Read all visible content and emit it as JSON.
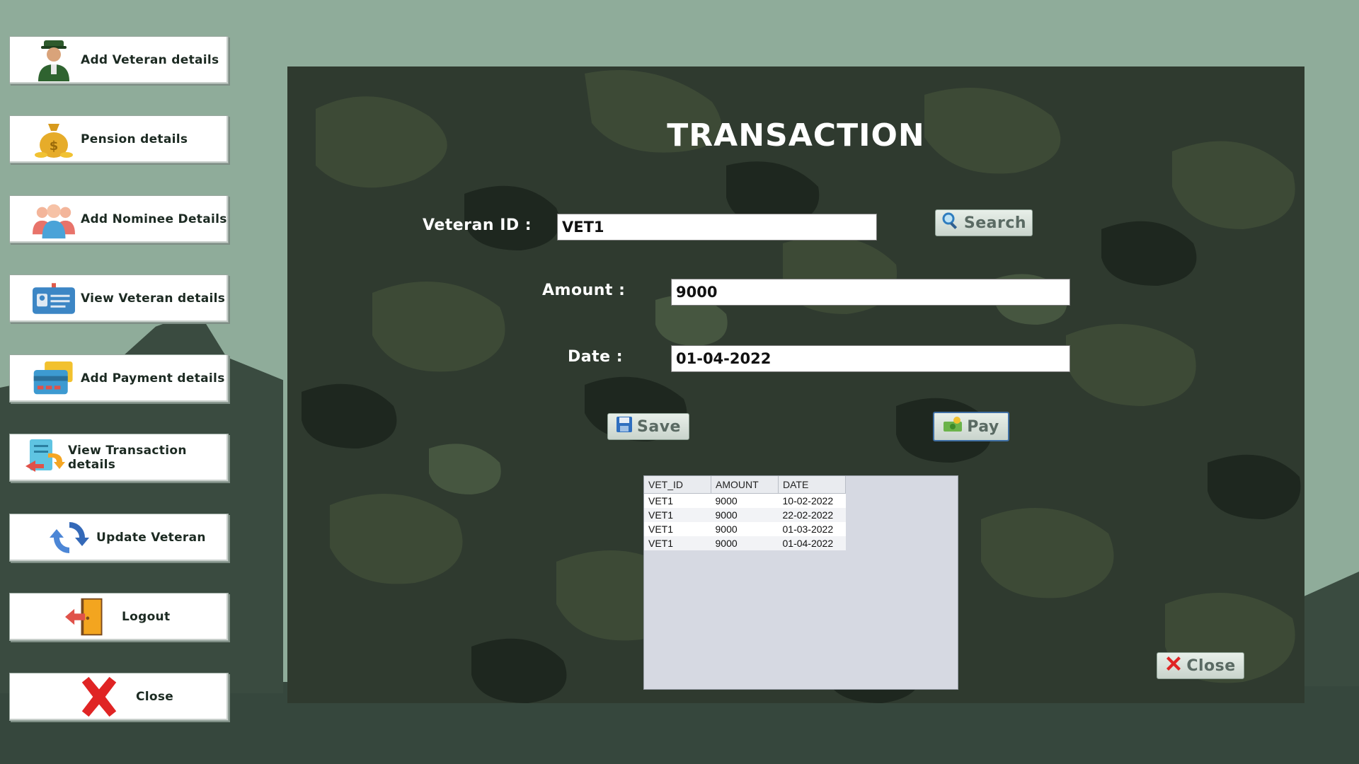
{
  "sidebar": {
    "items": [
      {
        "label": "Add Veteran details",
        "icon": "soldier-icon"
      },
      {
        "label": "Pension details",
        "icon": "money-bag-icon"
      },
      {
        "label": "Add Nominee Details",
        "icon": "people-icon"
      },
      {
        "label": "View Veteran details",
        "icon": "id-card-icon"
      },
      {
        "label": "Add Payment details",
        "icon": "card-wallet-icon"
      },
      {
        "label": "View Transaction details",
        "icon": "transfer-icon"
      },
      {
        "label": "Update Veteran",
        "icon": "refresh-icon"
      },
      {
        "label": "Logout",
        "icon": "logout-door-icon"
      },
      {
        "label": "Close",
        "icon": "close-x-icon"
      }
    ]
  },
  "main": {
    "title": "TRANSACTION",
    "veteran_id_label": "Veteran ID :",
    "veteran_id_value": "VET1",
    "amount_label": "Amount :",
    "amount_value": "9000",
    "date_label": "Date :",
    "date_value": "01-04-2022",
    "search_label": "Search",
    "save_label": "Save",
    "pay_label": "Pay",
    "close_label": "Close",
    "table": {
      "headers": [
        "VET_ID",
        "AMOUNT",
        "DATE"
      ],
      "rows": [
        [
          "VET1",
          "9000",
          "10-02-2022"
        ],
        [
          "VET1",
          "9000",
          "22-02-2022"
        ],
        [
          "VET1",
          "9000",
          "01-03-2022"
        ],
        [
          "VET1",
          "9000",
          "01-04-2022"
        ]
      ]
    }
  },
  "colors": {
    "background": "#8fac9a",
    "panel": "#2b352c",
    "accent_blue": "#3f6fa3"
  }
}
